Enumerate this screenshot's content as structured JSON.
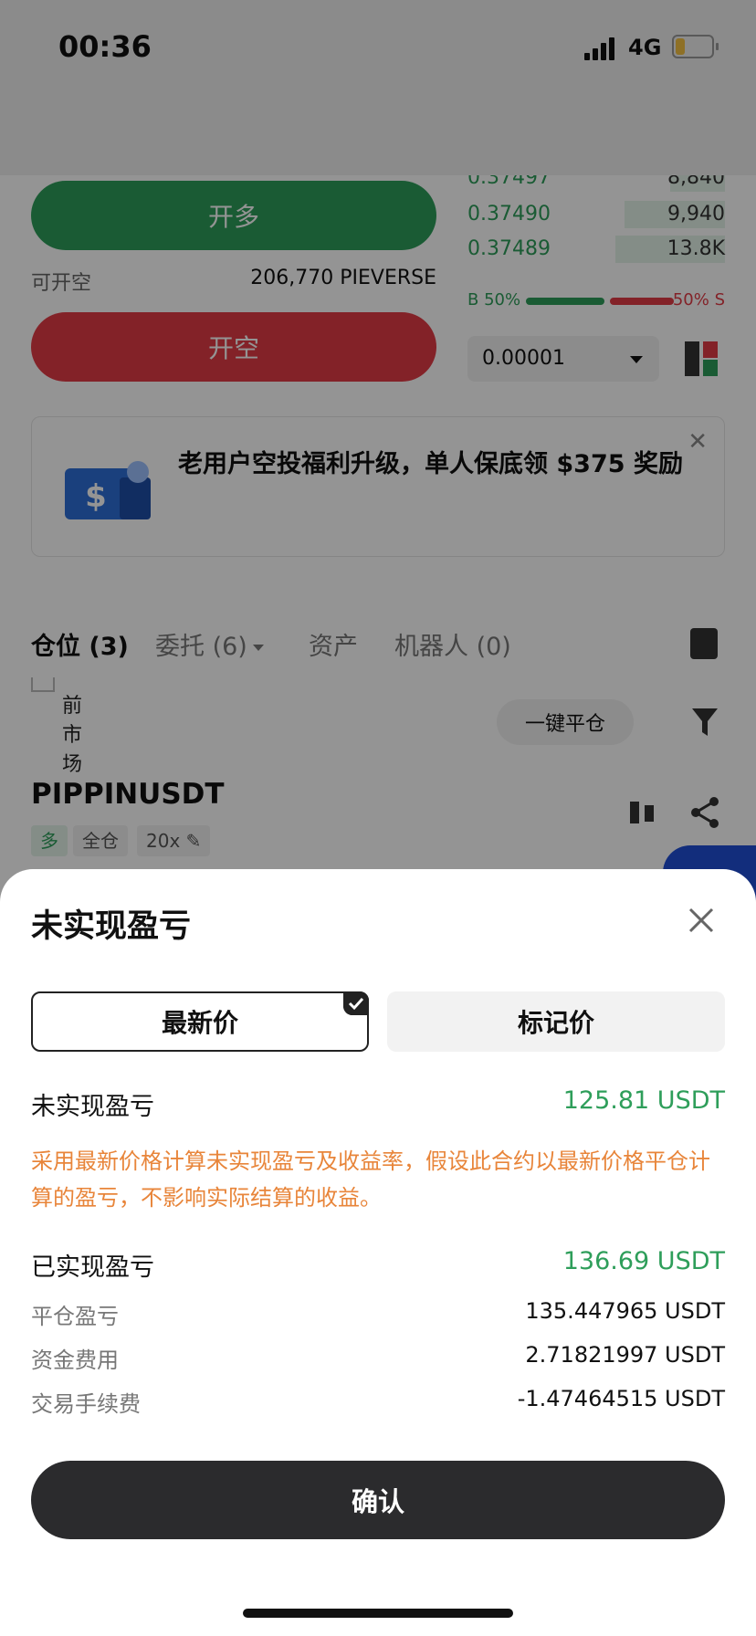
{
  "status_bar": {
    "time": "00:36",
    "network": "4G"
  },
  "trade_panel": {
    "long_button": "开多",
    "short_available_label": "可开空",
    "short_available_value": "206,770 PIEVERSE",
    "short_button": "开空"
  },
  "order_book": {
    "rows": [
      {
        "price": "0.37497",
        "qty": "8,840"
      },
      {
        "price": "0.37490",
        "qty": "9,940"
      },
      {
        "price": "0.37489",
        "qty": "13.8K"
      }
    ],
    "buy_ratio": "B 50%",
    "sell_ratio": "50% S",
    "tick_size": "0.00001"
  },
  "banner": {
    "text": "老用户空投福利升级，单人保底领 $375 奖励"
  },
  "tabs": [
    {
      "label": "仓位 (3)"
    },
    {
      "label": "委托 (6)"
    },
    {
      "label": "资产"
    },
    {
      "label": "机器人 (0)"
    }
  ],
  "positions": {
    "current_market_label": "前市场",
    "close_all_button": "一键平仓",
    "symbol": "PIPPINUSDT",
    "tags": {
      "side": "多",
      "margin_mode": "全仓",
      "leverage": "20x"
    }
  },
  "sheet": {
    "title": "未实现盈亏",
    "seg_latest": "最新价",
    "seg_mark": "标记价",
    "unrealized_label": "未实现盈亏",
    "unrealized_value": "125.81 USDT",
    "note": "采用最新价格计算未实现盈亏及收益率，假设此合约以最新价格平仓计算的盈亏，不影响实际结算的收益。",
    "realized_label": "已实现盈亏",
    "realized_value": "136.69 USDT",
    "close_pnl_label": "平仓盈亏",
    "close_pnl_value": "135.447965 USDT",
    "funding_label": "资金费用",
    "funding_value": "2.71821997 USDT",
    "fee_label": "交易手续费",
    "fee_value": "-1.47464515 USDT",
    "confirm_button": "确认"
  },
  "colors": {
    "green": "#2e9e5a",
    "red": "#e23b46",
    "orange": "#e8853a",
    "dark_button": "#2b2b2d"
  }
}
